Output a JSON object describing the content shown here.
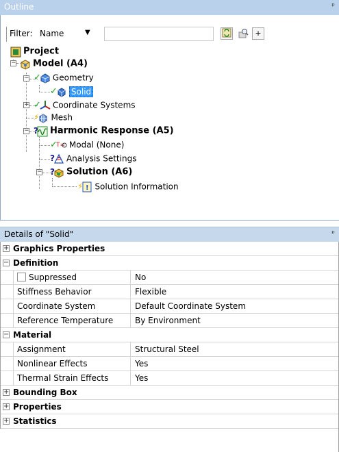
{
  "outline": {
    "title": "Outline",
    "pin_glyph": "ᵖ",
    "filter_label": "Filter:",
    "filter_value": "Name",
    "filter_text": "",
    "expand_glyph": "+"
  },
  "tree": {
    "project": "Project",
    "model": "Model (A4)",
    "geometry": "Geometry",
    "solid": "Solid",
    "coordinate_systems": "Coordinate Systems",
    "mesh": "Mesh",
    "harmonic_response": "Harmonic Response (A5)",
    "modal": "Modal (None)",
    "analysis_settings": "Analysis Settings",
    "solution": "Solution (A6)",
    "solution_information": "Solution Information"
  },
  "details": {
    "title": "Details of \"Solid\"",
    "pin_glyph": "ᵖ",
    "categories": {
      "graphics": "Graphics Properties",
      "definition": "Definition",
      "material": "Material",
      "bounding_box": "Bounding Box",
      "properties": "Properties",
      "statistics": "Statistics"
    },
    "rows": {
      "suppressed": {
        "name": "Suppressed",
        "value": "No"
      },
      "stiffness": {
        "name": "Stiffness Behavior",
        "value": "Flexible"
      },
      "coord_sys": {
        "name": "Coordinate System",
        "value": "Default Coordinate System"
      },
      "ref_temp": {
        "name": "Reference Temperature",
        "value": "By Environment"
      },
      "assignment": {
        "name": "Assignment",
        "value": "Structural Steel"
      },
      "nonlinear": {
        "name": "Nonlinear Effects",
        "value": "Yes"
      },
      "thermal": {
        "name": "Thermal Strain Effects",
        "value": "Yes"
      }
    }
  },
  "colors": {
    "header_bg": "#b9d1ea",
    "selection": "#3399ff",
    "ok_check": "#1fa31f"
  }
}
